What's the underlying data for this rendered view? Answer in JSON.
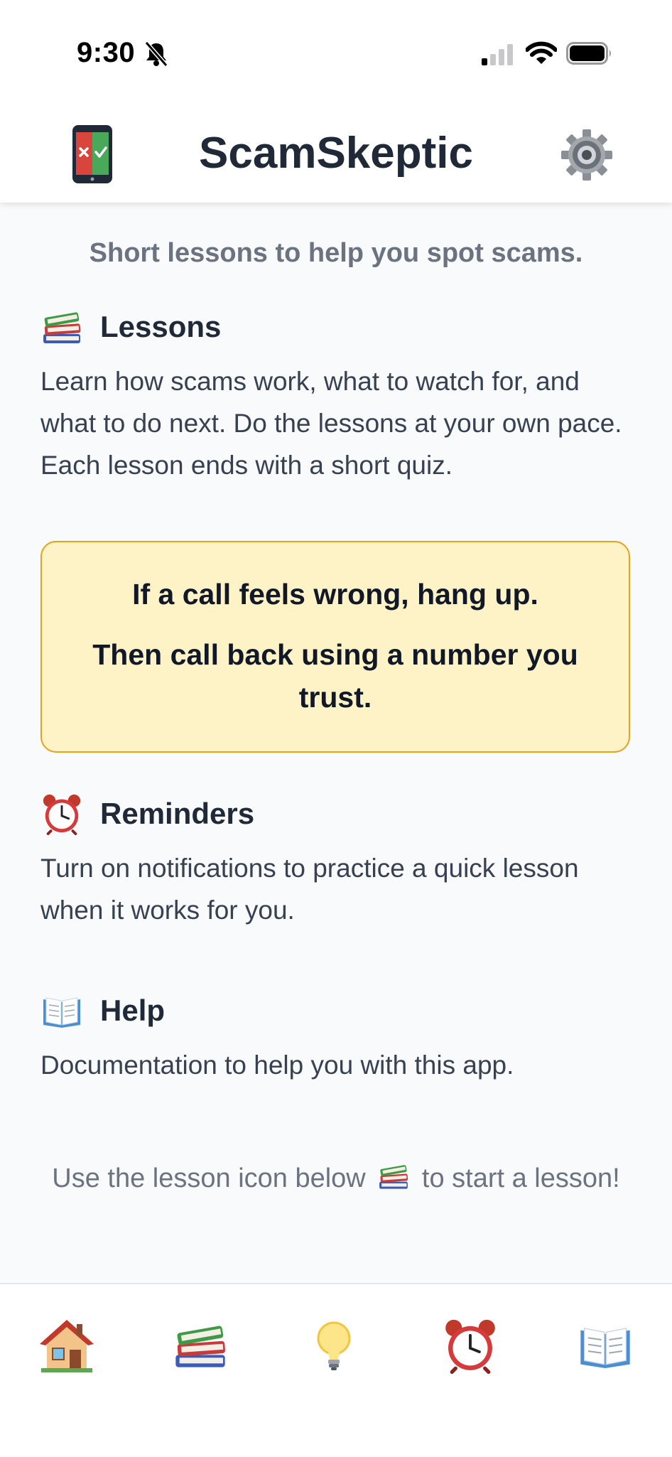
{
  "status_bar": {
    "time": "9:30",
    "icons": [
      "bell-slash-icon",
      "cellular-signal-icon",
      "wifi-icon",
      "battery-icon"
    ]
  },
  "header": {
    "title": "ScamSkeptic",
    "logo_icon": "phone-scam-check-icon",
    "settings_icon": "gear-icon"
  },
  "main": {
    "subtitle": "Short lessons to help you spot scams.",
    "sections": {
      "lessons": {
        "icon": "books-icon",
        "title": "Lessons",
        "body": "Learn how scams work, what to watch for, and what to do next. Do the lessons at your own pace. Each lesson ends with a short quiz."
      },
      "reminders": {
        "icon": "alarm-clock-icon",
        "title": "Reminders",
        "body": "Turn on notifications to practice a quick lesson when it works for you."
      },
      "help": {
        "icon": "open-book-icon",
        "title": "Help",
        "body": "Documentation to help you with this app."
      }
    },
    "tip": {
      "line1": "If a call feels wrong, hang up.",
      "line2": "Then call back using a number you trust."
    },
    "footer_hint": {
      "before": "Use the lesson icon below",
      "after": "to start a lesson!"
    }
  },
  "tab_bar": {
    "tabs": [
      {
        "icon": "house-icon"
      },
      {
        "icon": "books-icon"
      },
      {
        "icon": "light-bulb-icon"
      },
      {
        "icon": "alarm-clock-icon"
      },
      {
        "icon": "open-book-icon"
      }
    ]
  },
  "colors": {
    "background": "#f8fafc",
    "tip_background": "#fef3c7",
    "tip_border": "#e6a21b",
    "title_text": "#1f2937",
    "muted_text": "#6b7280"
  }
}
